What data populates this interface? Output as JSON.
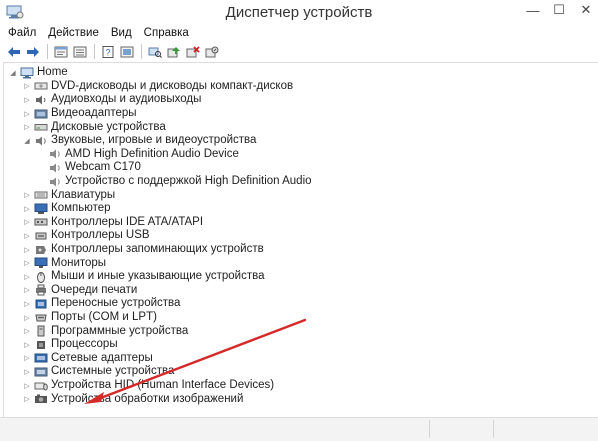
{
  "window": {
    "title": "Диспетчер устройств",
    "controls": {
      "minimize": "—",
      "maximize": "☐",
      "close": "✕"
    }
  },
  "menu": {
    "items": [
      "Файл",
      "Действие",
      "Вид",
      "Справка"
    ]
  },
  "toolbar": {
    "buttons": [
      "back-icon",
      "forward-icon",
      "properties-icon",
      "refresh-icon",
      "help-icon",
      "show-hidden-icon",
      "scan-hardware-icon",
      "update-driver-icon",
      "uninstall-icon",
      "disable-icon"
    ]
  },
  "tree": {
    "root": "Home",
    "items": [
      {
        "label": "DVD-дисководы и дисководы компакт-дисков",
        "expanded": false,
        "icon": "dvd-drive-icon"
      },
      {
        "label": "Аудиовходы и аудиовыходы",
        "expanded": false,
        "icon": "audio-io-icon"
      },
      {
        "label": "Видеоадаптеры",
        "expanded": false,
        "icon": "display-adapter-icon"
      },
      {
        "label": "Дисковые устройства",
        "expanded": false,
        "icon": "disk-drive-icon"
      },
      {
        "label": "Звуковые, игровые и видеоустройства",
        "expanded": true,
        "icon": "sound-icon",
        "children": [
          "AMD High Definition Audio Device",
          "Webcam C170",
          "Устройство с поддержкой High Definition Audio"
        ]
      },
      {
        "label": "Клавиатуры",
        "expanded": false,
        "icon": "keyboard-icon"
      },
      {
        "label": "Компьютер",
        "expanded": false,
        "icon": "computer-icon"
      },
      {
        "label": "Контроллеры IDE ATA/ATAPI",
        "expanded": false,
        "icon": "ide-controller-icon"
      },
      {
        "label": "Контроллеры USB",
        "expanded": false,
        "icon": "usb-controller-icon"
      },
      {
        "label": "Контроллеры запоминающих устройств",
        "expanded": false,
        "icon": "storage-controller-icon"
      },
      {
        "label": "Мониторы",
        "expanded": false,
        "icon": "monitor-icon"
      },
      {
        "label": "Мыши и иные указывающие устройства",
        "expanded": false,
        "icon": "mouse-icon"
      },
      {
        "label": "Очереди печати",
        "expanded": false,
        "icon": "print-queue-icon"
      },
      {
        "label": "Переносные устройства",
        "expanded": false,
        "icon": "portable-device-icon"
      },
      {
        "label": "Порты (COM и LPT)",
        "expanded": false,
        "icon": "port-icon"
      },
      {
        "label": "Программные устройства",
        "expanded": false,
        "icon": "software-device-icon"
      },
      {
        "label": "Процессоры",
        "expanded": false,
        "icon": "processor-icon"
      },
      {
        "label": "Сетевые адаптеры",
        "expanded": false,
        "icon": "network-adapter-icon"
      },
      {
        "label": "Системные устройства",
        "expanded": false,
        "icon": "system-device-icon"
      },
      {
        "label": "Устройства HID (Human Interface Devices)",
        "expanded": false,
        "icon": "hid-icon"
      },
      {
        "label": "Устройства обработки изображений",
        "expanded": false,
        "icon": "imaging-device-icon"
      }
    ]
  },
  "colors": {
    "annotation_arrow": "#d42a2a",
    "tree_line": "#dcdcdc",
    "icon_blue": "#3a6fb5",
    "icon_gray": "#7a7a7a"
  }
}
